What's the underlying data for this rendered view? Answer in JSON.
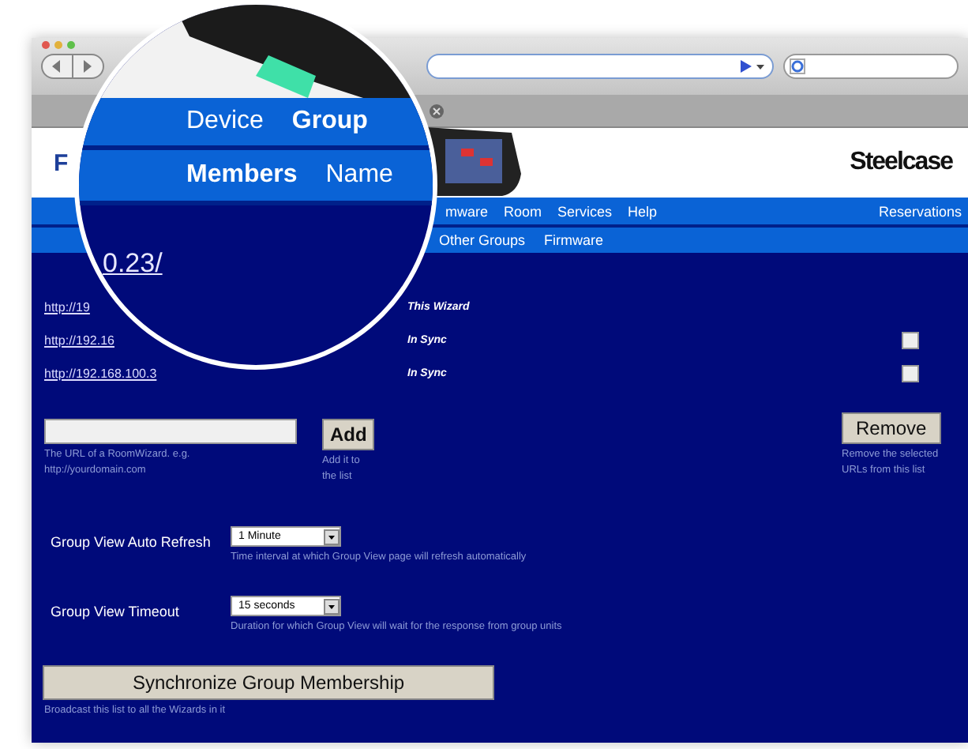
{
  "header": {
    "title": "F",
    "logo": "Steelcase"
  },
  "nav": {
    "items": [
      "mware",
      "Room",
      "Services",
      "Help"
    ],
    "right": "Reservations"
  },
  "subnav": [
    "Other Groups",
    "Firmware"
  ],
  "magnifier": {
    "tabs": [
      {
        "label": "Device",
        "selected": false
      },
      {
        "label": "Group",
        "selected": true
      }
    ],
    "subtabs": [
      {
        "label": "Members",
        "selected": true
      },
      {
        "label": "Name",
        "selected": false
      }
    ]
  },
  "group_title": "0.23/",
  "members": [
    {
      "url": "http://19",
      "status": "This Wizard",
      "kind": "self"
    },
    {
      "url": "http://192.16",
      "status": "In Sync",
      "kind": "member",
      "checked": false
    },
    {
      "url": "http://192.168.100.3",
      "status": "In Sync",
      "kind": "member",
      "checked": false
    }
  ],
  "add": {
    "hint": "The URL of a RoomWizard. e.g. http://yourdomain.com",
    "button": "Add",
    "button_hint": "Add it to the list"
  },
  "remove": {
    "button": "Remove",
    "hint": "Remove the selected URLs from this list"
  },
  "settings": [
    {
      "label": "Group View Auto Refresh",
      "value": "1 Minute",
      "hint": "Time interval at which Group View page will refresh automatically"
    },
    {
      "label": "Group View Timeout",
      "value": "15 seconds",
      "hint": "Duration for which Group View will wait for the response from group units"
    }
  ],
  "sync": {
    "button": "Synchronize Group Membership",
    "hint": "Broadcast this list to all the Wizards in it"
  }
}
